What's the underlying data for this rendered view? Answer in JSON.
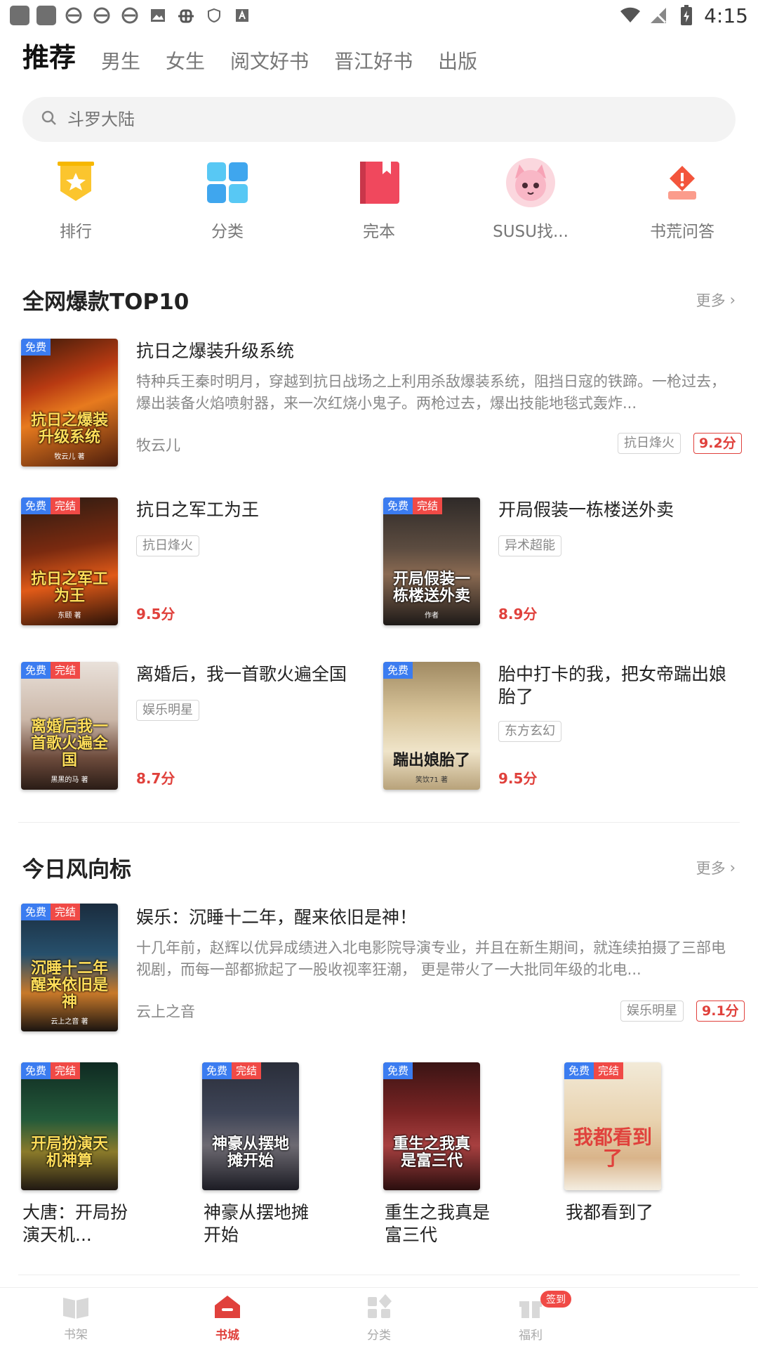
{
  "status_bar": {
    "time": "4:15"
  },
  "tabs": [
    {
      "label": "推荐"
    },
    {
      "label": "男生"
    },
    {
      "label": "女生"
    },
    {
      "label": "阅文好书"
    },
    {
      "label": "晋江好书"
    },
    {
      "label": "出版"
    }
  ],
  "search": {
    "placeholder": "斗罗大陆"
  },
  "quick": [
    {
      "label": "排行",
      "icon": "ranking-icon"
    },
    {
      "label": "分类",
      "icon": "category-icon"
    },
    {
      "label": "完本",
      "icon": "completed-book-icon"
    },
    {
      "label": "SUSU找...",
      "icon": "susu-avatar-icon"
    },
    {
      "label": "书荒问答",
      "icon": "qa-icon"
    }
  ],
  "section1": {
    "title": "全网爆款TOP10",
    "more": "更多",
    "featured": {
      "title": "抗日之爆装升级系统",
      "desc": "特种兵王秦时明月，穿越到抗日战场之上利用杀敌爆装系统，阻挡日寇的铁蹄。一枪过去，爆出装备火焰喷射器，来一次红烧小鬼子。两枪过去，爆出技能地毯式轰炸...",
      "author": "牧云儿",
      "tag": "抗日烽火",
      "score": "9.2分",
      "badge_free": "免费",
      "cover_title": "抗日之爆装升级系统",
      "cover_author": "牧云儿 著"
    },
    "books": [
      {
        "title": "抗日之军工为王",
        "tag": "抗日烽火",
        "score": "9.5分",
        "free": "免费",
        "done": "完结",
        "cover_title": "抗日之军工为王",
        "cover_author": "东颐 著"
      },
      {
        "title": "开局假装一栋楼送外卖",
        "tag": "异术超能",
        "score": "8.9分",
        "free": "免费",
        "done": "完结",
        "cover_title": "开局假装一栋楼送外卖",
        "cover_author": "作者"
      },
      {
        "title": "离婚后，我一首歌火遍全国",
        "tag": "娱乐明星",
        "score": "8.7分",
        "free": "免费",
        "done": "完结",
        "cover_title": "离婚后我一首歌火遍全国",
        "cover_author": "黑黑的马 著"
      },
      {
        "title": "胎中打卡的我，把女帝踹出娘胎了",
        "tag": "东方玄幻",
        "score": "9.5分",
        "free": "免费",
        "cover_title": "踹出娘胎了",
        "cover_author": "笑饮71 著"
      }
    ]
  },
  "section2": {
    "title": "今日风向标",
    "more": "更多",
    "featured": {
      "title": "娱乐：沉睡十二年，醒来依旧是神！",
      "desc": "十几年前，赵辉以优异成绩进入北电影院导演专业，并且在新生期间，就连续拍摄了三部电视剧，而每一部都掀起了一股收视率狂潮， 更是带火了一大批同年级的北电...",
      "author": "云上之音",
      "tag": "娱乐明星",
      "score": "9.1分",
      "badge_free": "免费",
      "badge_done": "完结",
      "cover_title": "沉睡十二年醒来依旧是神",
      "cover_author": "云上之音 著"
    },
    "books": [
      {
        "title": "大唐：开局扮演天机...",
        "free": "免费",
        "done": "完结",
        "cover_title": "开局扮演天机神算"
      },
      {
        "title": "神豪从摆地摊开始",
        "free": "免费",
        "done": "完结",
        "cover_title": "神豪从摆地摊开始"
      },
      {
        "title": "重生之我真是富三代",
        "free": "免费",
        "cover_title": "重生之我真是富三代"
      },
      {
        "title": "我都看到了",
        "free": "免费",
        "done": "完结",
        "cover_title": "我都看到了"
      }
    ]
  },
  "bottom_nav": [
    {
      "label": "书架"
    },
    {
      "label": "书城"
    },
    {
      "label": "分类"
    },
    {
      "label": "福利",
      "badge": "签到"
    }
  ],
  "colors": {
    "accent": "#e0413c",
    "free_badge": "#3b7cf0",
    "done_badge": "#f04a46"
  }
}
